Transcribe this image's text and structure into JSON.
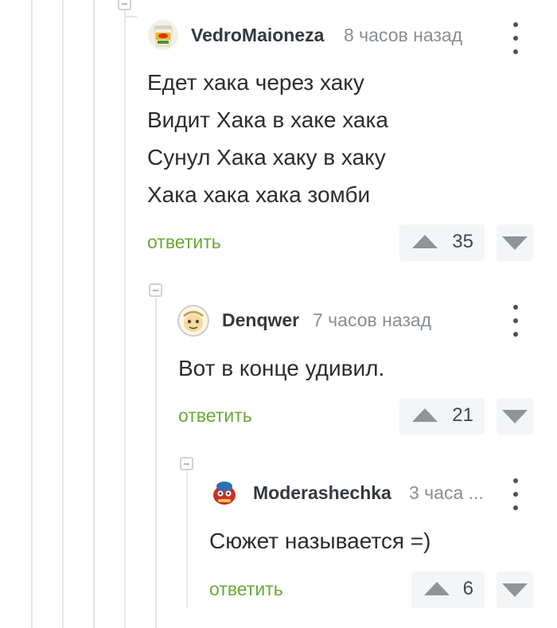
{
  "comments": [
    {
      "username": "VedroMaioneza",
      "timestamp": "8 часов назад",
      "text": "Едет хака через хаку\nВидит Хака в хаке хака\nСунул Хака хаку в хаку\nХака хака хака зомби",
      "reply_label": "ответить",
      "votes": "35",
      "avatar_icon": "mayonnaise-bucket-icon"
    },
    {
      "username": "Denqwer",
      "timestamp": "7 часов назад",
      "text": "Вот в конце удивил.",
      "reply_label": "ответить",
      "votes": "21",
      "avatar_icon": "cartoon-face-icon"
    },
    {
      "username": "Moderashechka",
      "timestamp": "3 часа ...",
      "text": "Сюжет называется =)",
      "reply_label": "ответить",
      "votes": "6",
      "avatar_icon": "cartoon-character-icon"
    }
  ],
  "colors": {
    "reply_link": "#6aa835",
    "username": "#36393c",
    "timestamp": "#8a8e92",
    "thread_line": "#e4e6e8",
    "vote_bg": "#f4f5f6"
  }
}
